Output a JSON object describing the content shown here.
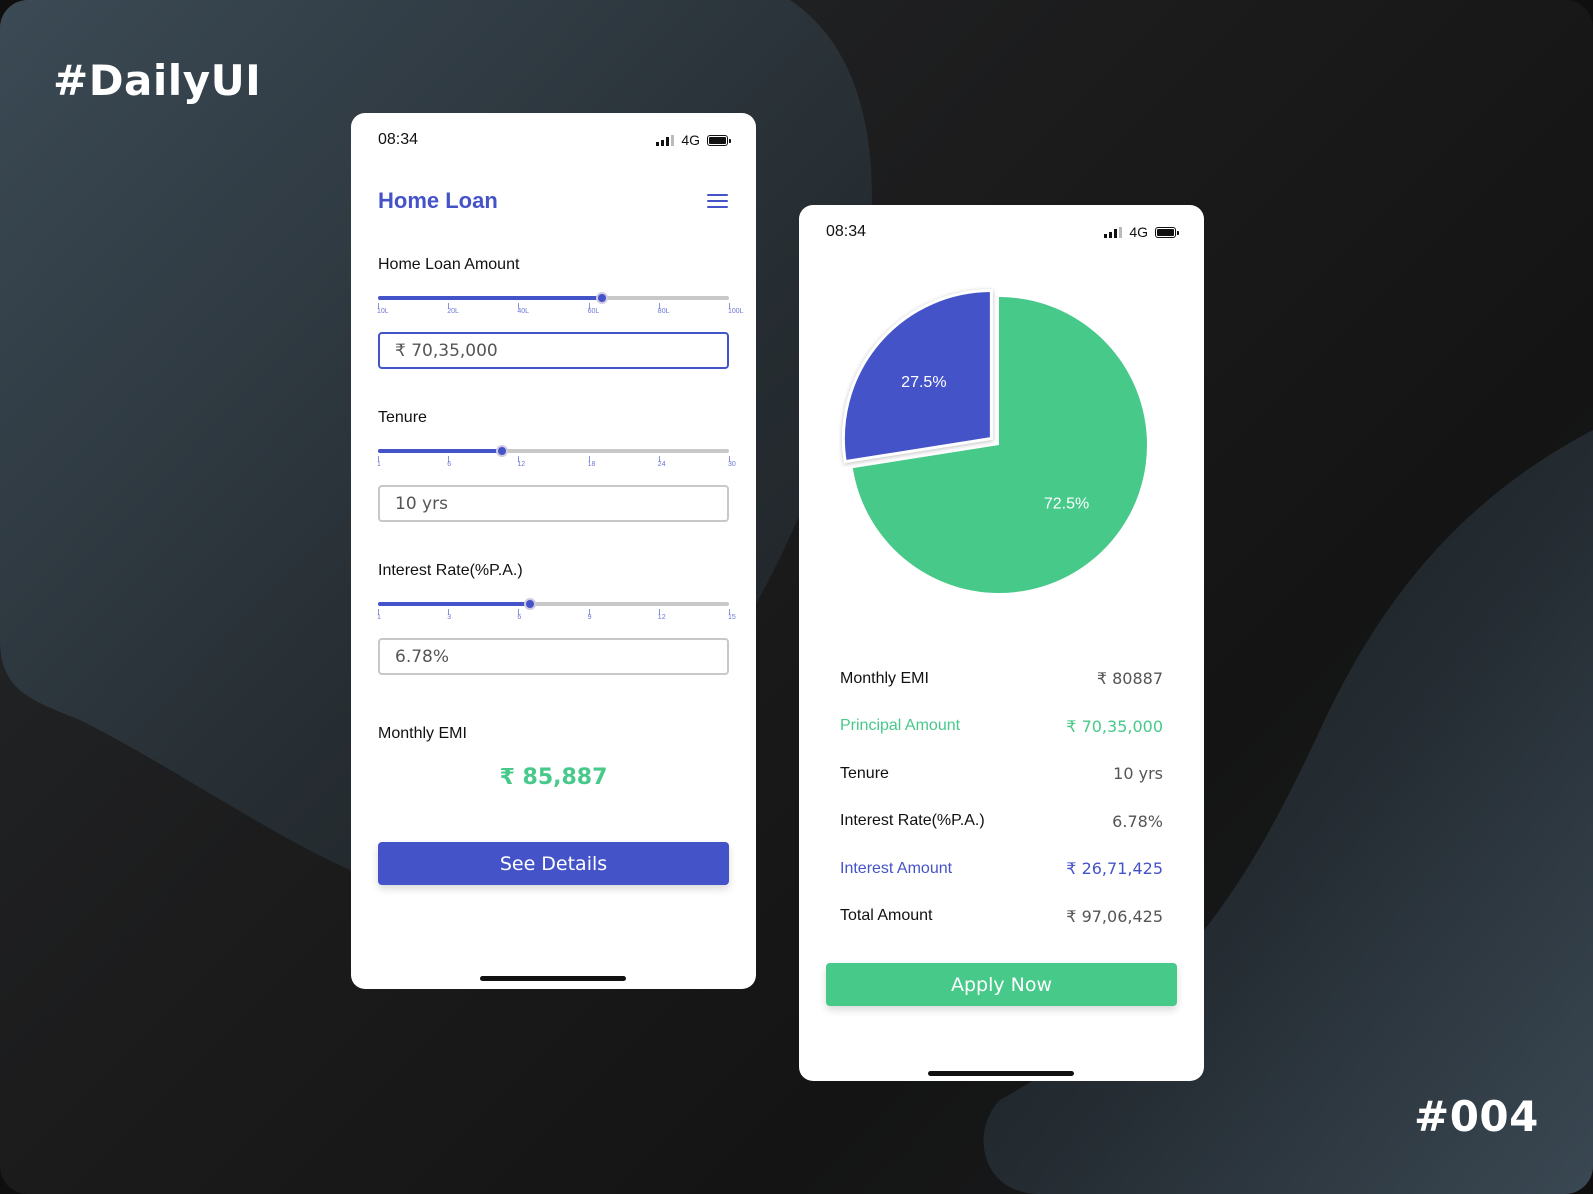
{
  "branding": {
    "tag": "#DailyUI",
    "challenge_number": "#004"
  },
  "colors": {
    "primary": "#4553c9",
    "accent_green": "#47c98a",
    "track_grey": "#c8c8c8"
  },
  "calculator_screen": {
    "status_bar": {
      "time": "08:34",
      "network": "4G"
    },
    "title": "Home Loan",
    "menu_icon": "hamburger-menu-icon",
    "loan_amount": {
      "label": "Home Loan Amount",
      "ticks": [
        "10L",
        "20L",
        "40L",
        "60L",
        "80L",
        "100L"
      ],
      "slider_fraction": 0.637,
      "value": "₹ 70,35,000"
    },
    "tenure": {
      "label": "Tenure",
      "ticks": [
        "1",
        "6",
        "12",
        "18",
        "24",
        "30"
      ],
      "slider_fraction": 0.353,
      "value": "10 yrs"
    },
    "interest_rate": {
      "label": "Interest Rate(%P.A.)",
      "ticks": [
        "1",
        "3",
        "6",
        "9",
        "12",
        "15"
      ],
      "slider_fraction": 0.432,
      "value": "6.78%"
    },
    "monthly_emi": {
      "label": "Monthly EMI",
      "value": "₹ 85,887"
    },
    "see_details_button": "See Details"
  },
  "details_screen": {
    "status_bar": {
      "time": "08:34",
      "network": "4G"
    },
    "rows": [
      {
        "label": "Monthly EMI",
        "value": "₹  80887",
        "style": "default"
      },
      {
        "label": "Principal Amount",
        "value": "₹  70,35,000",
        "style": "green"
      },
      {
        "label": "Tenure",
        "value": "10 yrs",
        "style": "default"
      },
      {
        "label": "Interest Rate(%P.A.)",
        "value": "6.78%",
        "style": "default"
      },
      {
        "label": "Interest Amount",
        "value": "₹  26,71,425",
        "style": "blue"
      },
      {
        "label": "Total Amount",
        "value": "₹  97,06,425",
        "style": "default"
      }
    ],
    "apply_button": "Apply Now"
  },
  "chart_data": {
    "type": "pie",
    "title": "",
    "slices": [
      {
        "name": "Interest Amount",
        "value": 27.5,
        "label": "27.5%",
        "color": "#4553c9",
        "exploded": true
      },
      {
        "name": "Principal Amount",
        "value": 72.5,
        "label": "72.5%",
        "color": "#47c98a",
        "exploded": false
      }
    ],
    "start_angle_deg": -90,
    "legend": "none"
  }
}
